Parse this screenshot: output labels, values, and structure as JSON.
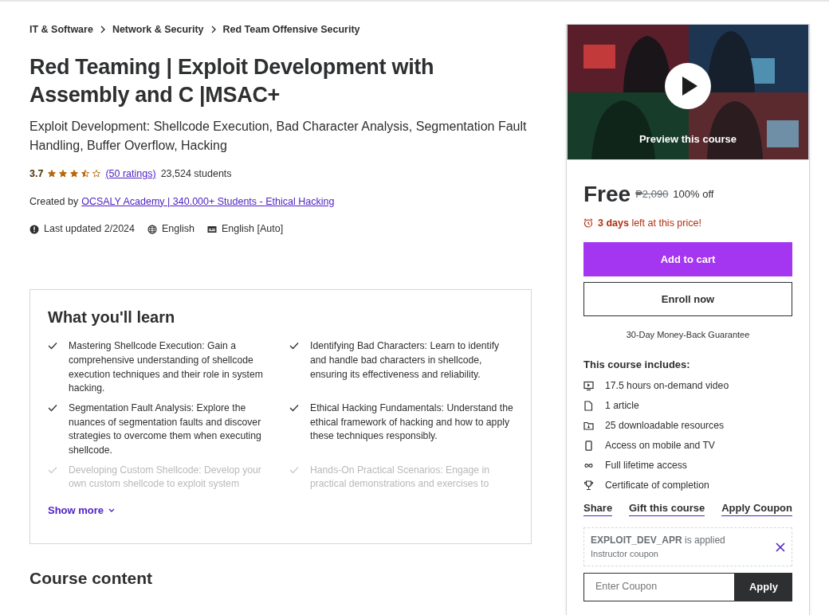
{
  "breadcrumbs": [
    "IT & Software",
    "Network & Security",
    "Red Team Offensive Security"
  ],
  "course": {
    "title": "Red Teaming | Exploit Development with Assembly and C |MSAC+",
    "subtitle": "Exploit Development: Shellcode Execution, Bad Character Analysis, Segmentation Fault Handling, Buffer Overflow, Hacking",
    "rating": {
      "value": "3.7",
      "stars": 3.5,
      "ratings_link": "(50 ratings)",
      "students": "23,524 students"
    },
    "created_by": {
      "label": "Created by",
      "author": "OCSALY Academy | 340.000+ Students - Ethical Hacking"
    },
    "meta": [
      {
        "kind": "updated",
        "text": "Last updated 2/2024"
      },
      {
        "kind": "language",
        "text": "English"
      },
      {
        "kind": "captions",
        "text": "English [Auto]"
      }
    ]
  },
  "learn": {
    "title": "What you'll learn",
    "items": [
      {
        "text": "Mastering Shellcode Execution: Gain a comprehensive understanding of shellcode execution techniques and their role in system hacking.",
        "faded": false
      },
      {
        "text": "Identifying Bad Characters: Learn to identify and handle bad characters in shellcode, ensuring its effectiveness and reliability.",
        "faded": false
      },
      {
        "text": "Segmentation Fault Analysis: Explore the nuances of segmentation faults and discover strategies to overcome them when executing shellcode.",
        "faded": false
      },
      {
        "text": "Ethical Hacking Fundamentals: Understand the ethical framework of hacking and how to apply these techniques responsibly.",
        "faded": false
      },
      {
        "text": "Developing Custom Shellcode: Develop your own custom shellcode to exploit system",
        "faded": true
      },
      {
        "text": "Hands-On Practical Scenarios: Engage in practical demonstrations and exercises to",
        "faded": true
      }
    ],
    "show_more": "Show more"
  },
  "course_content_title": "Course content",
  "sidebar": {
    "preview_label": "Preview this course",
    "price": {
      "current": "Free",
      "original": "₱2,090",
      "discount": "100% off"
    },
    "deadline": "**3 days** left at this price!",
    "add_to_cart": "Add to cart",
    "enroll_now": "Enroll now",
    "guarantee": "30-Day Money-Back Guarantee",
    "includes": {
      "title": "This course includes:",
      "items": [
        {
          "kind": "video",
          "text": "17.5 hours on-demand video"
        },
        {
          "kind": "article",
          "text": "1 article"
        },
        {
          "kind": "download",
          "text": "25 downloadable resources"
        },
        {
          "kind": "mobile",
          "text": "Access on mobile and TV"
        },
        {
          "kind": "lifetime",
          "text": "Full lifetime access"
        },
        {
          "kind": "certificate",
          "text": "Certificate of completion"
        }
      ]
    },
    "actions": [
      "Share",
      "Gift this course",
      "Apply Coupon"
    ],
    "coupon": {
      "code": "EXPLOIT_DEV_APR",
      "status": "is applied",
      "type": "Instructor coupon"
    },
    "coupon_form": {
      "placeholder": "Enter Coupon",
      "button": "Apply"
    }
  }
}
